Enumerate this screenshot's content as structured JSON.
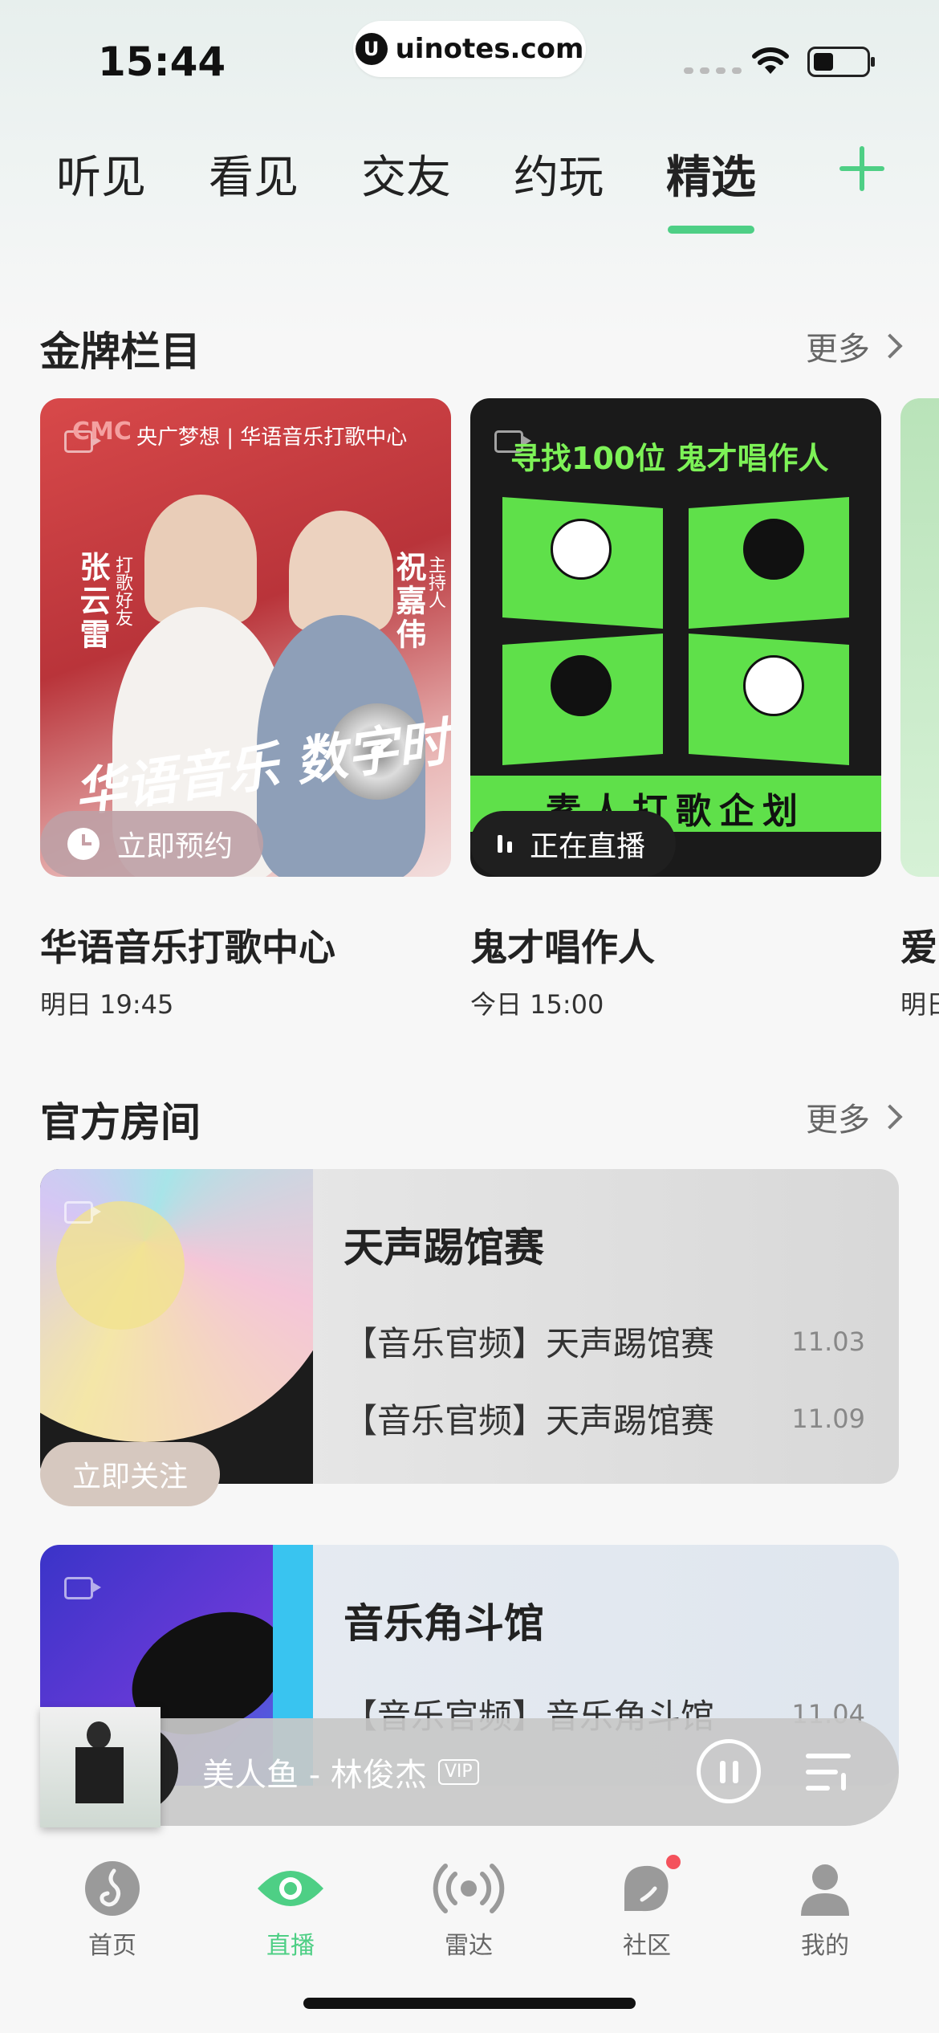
{
  "status_bar": {
    "time": "15:44",
    "url": "uinotes.com",
    "url_logo": "U"
  },
  "top_tabs": [
    {
      "label": "听见",
      "active": false
    },
    {
      "label": "看见",
      "active": false
    },
    {
      "label": "交友",
      "active": false
    },
    {
      "label": "约玩",
      "active": false
    },
    {
      "label": "精选",
      "active": true
    }
  ],
  "accent_color": "#4ecf85",
  "gold_section": {
    "title": "金牌栏目",
    "more": "更多",
    "cards": [
      {
        "name": "华语音乐打歌中心",
        "time": "明日 19:45",
        "badge": "立即预约",
        "poster": {
          "header": "央广梦想 | 华语音乐打歌中心",
          "logo": "CMC",
          "left_name": "张云雷",
          "left_role": "打歌好友",
          "right_name": "祝嘉伟",
          "right_role": "主持人",
          "slogan": "华语音乐 数字时代"
        }
      },
      {
        "name": "鬼才唱作人",
        "time": "今日 15:00",
        "badge": "正在直播",
        "poster": {
          "title": "寻找100位 鬼才唱作人",
          "band": "素人打歌企划"
        }
      },
      {
        "name": "爱",
        "time": "明日",
        "badge": ""
      }
    ]
  },
  "official_section": {
    "title": "官方房间",
    "more": "更多",
    "rooms": [
      {
        "title": "天声踢馆赛",
        "follow": "立即关注",
        "rows": [
          {
            "text": "【音乐官频】天声踢馆赛",
            "date": "11.03"
          },
          {
            "text": "【音乐官频】天声踢馆赛",
            "date": "11.09"
          }
        ]
      },
      {
        "title": "音乐角斗馆",
        "rows": [
          {
            "text": "【音乐官频】音乐角斗馆",
            "date": "11.04"
          }
        ]
      }
    ]
  },
  "player": {
    "track": "美人鱼 - 林俊杰",
    "vip": "VIP"
  },
  "bottom_nav": [
    {
      "label": "首页",
      "icon": "music-note-icon",
      "active": false
    },
    {
      "label": "直播",
      "icon": "eye-icon",
      "active": true
    },
    {
      "label": "雷达",
      "icon": "radar-icon",
      "active": false
    },
    {
      "label": "社区",
      "icon": "community-icon",
      "active": false,
      "badge_dot": true
    },
    {
      "label": "我的",
      "icon": "profile-icon",
      "active": false
    }
  ]
}
